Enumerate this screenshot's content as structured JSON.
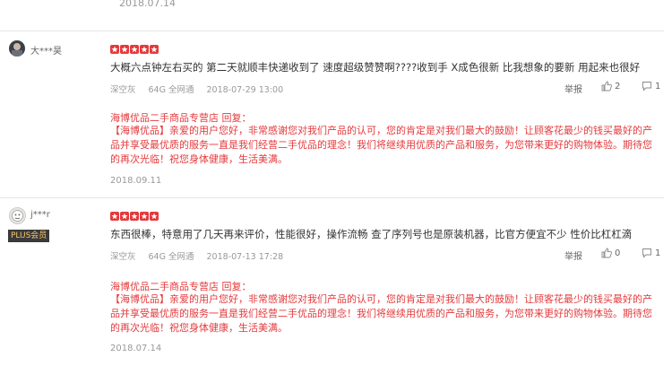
{
  "top": {
    "date": "2018.07.14"
  },
  "star_color": "#e4393c",
  "reviews": [
    {
      "user": "大***昊",
      "badge": "",
      "stars": 5,
      "content": "大概六点钟左右买的 第二天就顺丰快递收到了 速度超级赞赞啊????收到手 X成色很新 比我想象的要新 用起来也很好",
      "color": "深空灰",
      "capacity": "64G 全网通",
      "time": "2018-07-29 13:00",
      "report_label": "举报",
      "likes": "2",
      "comments": "1",
      "reply": {
        "shop": "海博优品二手商品专营店",
        "reply_label": "回复：",
        "text": "【海博优品】亲爱的用户您好，非常感谢您对我们产品的认可，您的肯定是对我们最大的鼓励！让顾客花最少的钱买最好的产品并享受最优质的服务一直是我们经营二手优品的理念！我们将继续用优质的产品和服务，为您带来更好的购物体验。期待您的再次光临！祝您身体健康，生活美满。",
        "date": "2018.09.11"
      }
    },
    {
      "user": "j***r",
      "badge": "PLUS会员",
      "stars": 5,
      "content": "东西很棒，特意用了几天再来评价，性能很好，操作流畅 查了序列号也是原装机器，比官方便宜不少 性价比杠杠滴",
      "color": "深空灰",
      "capacity": "64G 全网通",
      "time": "2018-07-13 17:28",
      "report_label": "举报",
      "likes": "0",
      "comments": "1",
      "reply": {
        "shop": "海博优品二手商品专营店",
        "reply_label": "回复：",
        "text": "【海博优品】亲爱的用户您好，非常感谢您对我们产品的认可，您的肯定是对我们最大的鼓励！让顾客花最少的钱买最好的产品并享受最优质的服务一直是我们经营二手优品的理念！我们将继续用优质的产品和服务，为您带来更好的购物体验。期待您的再次光临！祝您身体健康，生活美满。",
        "date": "2018.07.14"
      }
    }
  ]
}
